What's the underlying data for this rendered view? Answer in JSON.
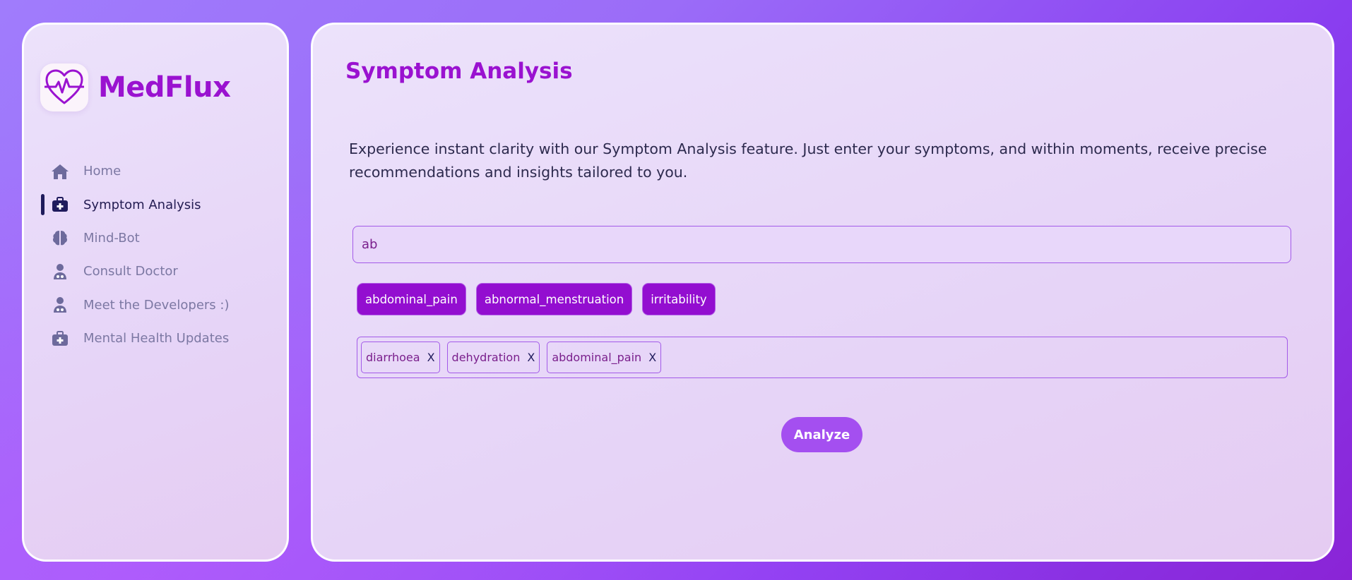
{
  "brand": {
    "name": "MedFlux",
    "logo_icon": "heart-pulse-icon",
    "color": "#9a12d0"
  },
  "sidebar": {
    "items": [
      {
        "label": "Home",
        "icon": "home-icon",
        "active": false
      },
      {
        "label": "Symptom Analysis",
        "icon": "medical-kit-icon",
        "active": true
      },
      {
        "label": "Mind-Bot",
        "icon": "brain-icon",
        "active": false
      },
      {
        "label": "Consult Doctor",
        "icon": "doctor-icon",
        "active": false
      },
      {
        "label": "Meet the Developers :)",
        "icon": "doctor-icon",
        "active": false
      },
      {
        "label": "Mental Health Updates",
        "icon": "medical-kit-icon",
        "active": false
      }
    ]
  },
  "main": {
    "title": "Symptom Analysis",
    "description": "Experience instant clarity with our Symptom Analysis feature. Just enter your symptoms, and within moments, receive precise recommendations and insights tailored to you.",
    "search": {
      "value": "ab"
    },
    "suggestions": [
      "abdominal_pain",
      "abnormal_menstruation",
      "irritability"
    ],
    "selected": [
      {
        "label": "diarrhoea",
        "remove": "X"
      },
      {
        "label": "dehydration",
        "remove": "X"
      },
      {
        "label": "abdominal_pain",
        "remove": "X"
      }
    ],
    "analyze_label": "Analyze"
  },
  "colors": {
    "accent": "#9a12d0",
    "button": "#a44ff0",
    "nav_active": "#231c52",
    "nav_inactive": "#7c78a3"
  }
}
